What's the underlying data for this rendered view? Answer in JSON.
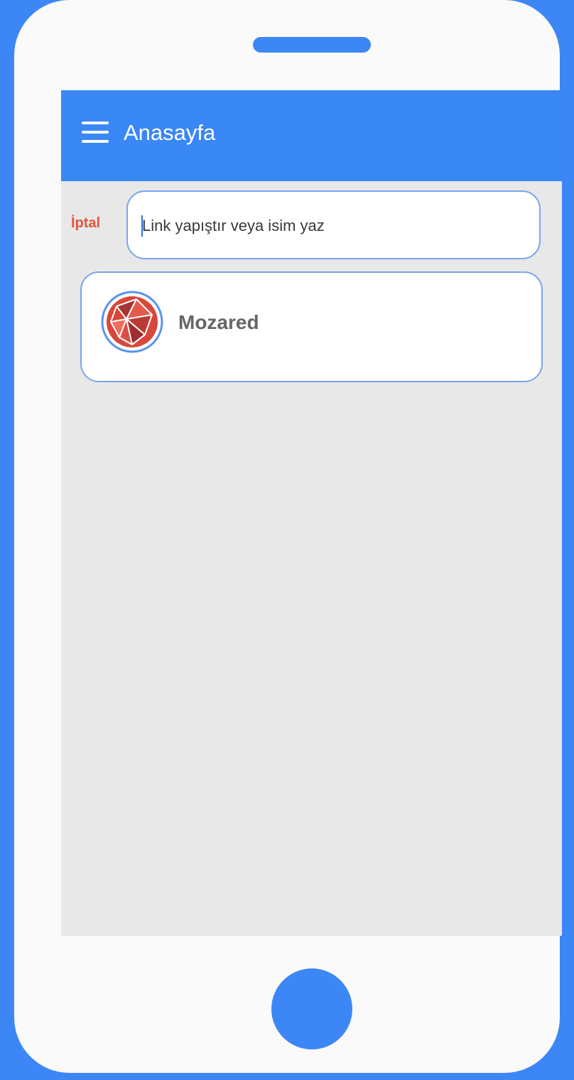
{
  "app_bar": {
    "title": "Anasayfa",
    "menu_icon": "hamburger-menu-icon",
    "background": "#3a87f6"
  },
  "search": {
    "cancel_label": "İptal",
    "placeholder": "Link yapıştır veya isim yaz",
    "value": ""
  },
  "results": [
    {
      "name": "Mozared",
      "avatar_icon": "mozared-logo-icon"
    }
  ],
  "colors": {
    "accent": "#3d86f5",
    "cancel": "#e4563c",
    "border": "#7aa6ec",
    "screen_background": "#e8e8e8"
  }
}
